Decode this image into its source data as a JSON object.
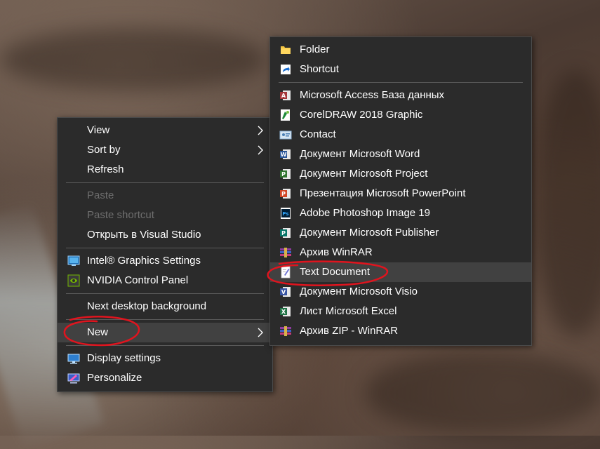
{
  "main_menu": {
    "items": [
      {
        "label": "View"
      },
      {
        "label": "Sort by"
      },
      {
        "label": "Refresh"
      },
      {
        "label": "Paste"
      },
      {
        "label": "Paste shortcut"
      },
      {
        "label": "Открыть в Visual Studio"
      },
      {
        "label": "Intel® Graphics Settings",
        "icon": "intel-graphics-icon"
      },
      {
        "label": "NVIDIA Control Panel",
        "icon": "nvidia-icon"
      },
      {
        "label": "Next desktop background"
      },
      {
        "label": "New"
      },
      {
        "label": "Display settings",
        "icon": "display-icon"
      },
      {
        "label": "Personalize",
        "icon": "personalize-icon"
      }
    ]
  },
  "new_submenu": {
    "items": [
      {
        "label": "Folder",
        "icon": "folder-icon"
      },
      {
        "label": "Shortcut",
        "icon": "shortcut-icon"
      },
      {
        "label": "Microsoft Access База данных",
        "icon": "access-icon"
      },
      {
        "label": "CorelDRAW 2018 Graphic",
        "icon": "coreldraw-icon"
      },
      {
        "label": "Contact",
        "icon": "contact-icon"
      },
      {
        "label": "Документ Microsoft Word",
        "icon": "word-icon"
      },
      {
        "label": "Документ Microsoft Project",
        "icon": "project-icon"
      },
      {
        "label": "Презентация Microsoft PowerPoint",
        "icon": "powerpoint-icon"
      },
      {
        "label": "Adobe Photoshop Image 19",
        "icon": "photoshop-icon"
      },
      {
        "label": "Документ Microsoft Publisher",
        "icon": "publisher-icon"
      },
      {
        "label": "Архив WinRAR",
        "icon": "winrar-icon"
      },
      {
        "label": "Text Document",
        "icon": "text-document-icon"
      },
      {
        "label": "Документ Microsoft Visio",
        "icon": "visio-icon"
      },
      {
        "label": "Лист Microsoft Excel",
        "icon": "excel-icon"
      },
      {
        "label": "Архив ZIP - WinRAR",
        "icon": "winrar-zip-icon"
      }
    ]
  },
  "colors": {
    "menu_bg": "#2b2b2b",
    "highlight": "#414141",
    "annotation": "#e0141e"
  }
}
